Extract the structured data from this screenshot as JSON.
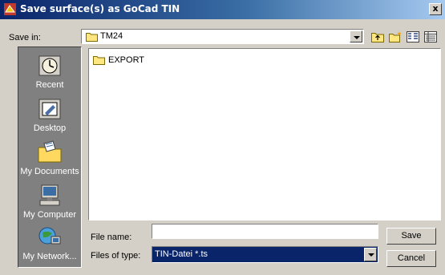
{
  "window": {
    "title": "Save surface(s) as GoCad TIN",
    "close_glyph": "x"
  },
  "save_in": {
    "label": "Save in:",
    "value": "TM24"
  },
  "toolbar": {
    "icons": [
      "up-folder-icon",
      "new-folder-icon",
      "list-view-icon",
      "details-view-icon"
    ]
  },
  "places": [
    {
      "label": "Recent",
      "icon": "recent-icon"
    },
    {
      "label": "Desktop",
      "icon": "desktop-icon"
    },
    {
      "label": "My Documents",
      "icon": "my-documents-icon"
    },
    {
      "label": "My Computer",
      "icon": "my-computer-icon"
    },
    {
      "label": "My Network...",
      "icon": "my-network-icon"
    }
  ],
  "files": [
    {
      "name": "EXPORT",
      "icon": "folder-icon"
    }
  ],
  "file_name": {
    "label": "File name:",
    "value": ""
  },
  "file_type": {
    "label": "Files of type:",
    "value": "TIN-Datei *.ts"
  },
  "buttons": {
    "save": "Save",
    "cancel": "Cancel"
  },
  "colors": {
    "selection": "#0a246a",
    "places_bg": "#808080",
    "dialog_bg": "#d4d0c8"
  }
}
